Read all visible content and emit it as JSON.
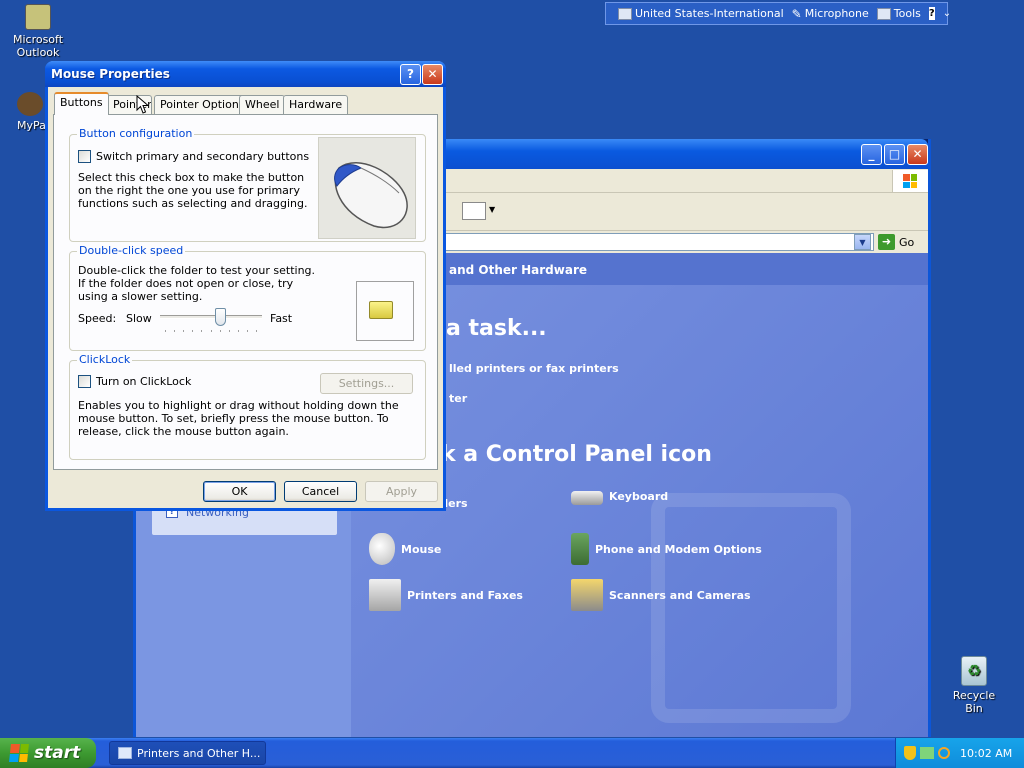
{
  "language_bar": {
    "language": "United States-International",
    "microphone": "Microphone",
    "tools": "Tools",
    "help": "?",
    "more": "⌄"
  },
  "desktop": {
    "icons": [
      {
        "label": "Microsoft Outlook"
      },
      {
        "label": "MyPa"
      },
      {
        "label": "Recycle Bin"
      }
    ]
  },
  "control_panel": {
    "address_go": "Go",
    "header_title": "and Other Hardware",
    "pick_task": "a task...",
    "task_links": [
      "lled printers or fax printers",
      "ter"
    ],
    "pick_icon": "k a Control Panel icon",
    "sidebar_link": "Networking",
    "icons": [
      {
        "label": "ontrollers"
      },
      {
        "label": "Keyboard"
      },
      {
        "label": "Mouse"
      },
      {
        "label": "Phone and Modem Options"
      },
      {
        "label": "Printers and Faxes"
      },
      {
        "label": "Scanners and Cameras"
      }
    ]
  },
  "dialog": {
    "title": "Mouse Properties",
    "help_btn": "?",
    "close_btn": "✕",
    "tabs": [
      "Buttons",
      "Pointers",
      "Pointer Options",
      "Wheel",
      "Hardware"
    ],
    "active_tab": "Buttons",
    "button_config": {
      "legend": "Button configuration",
      "checkbox_label": "Switch primary and secondary buttons",
      "checked": false,
      "description": "Select this check box to make the button on the right the one you use for primary functions such as selecting and dragging."
    },
    "double_click": {
      "legend": "Double-click speed",
      "description": "Double-click the folder to test your setting. If the folder does not open or close, try using a slower setting.",
      "speed_label": "Speed:",
      "slow_label": "Slow",
      "fast_label": "Fast",
      "slider_value": 0.6
    },
    "clicklock": {
      "legend": "ClickLock",
      "checkbox_label": "Turn on ClickLock",
      "checked": false,
      "settings_btn": "Settings...",
      "description": "Enables you to highlight or drag without holding down the mouse button. To set, briefly press the mouse button. To release, click the mouse button again."
    },
    "ok": "OK",
    "cancel": "Cancel",
    "apply": "Apply"
  },
  "taskbar": {
    "start": "start",
    "task_item": "Printers and Other H...",
    "clock": "10:02 AM"
  },
  "colors": {
    "desktop": "#1f4fa6",
    "title_blue": "#0a57e0",
    "start_green": "#3d9a31",
    "legend_blue": "#0046d5",
    "tab_highlight": "#e68b2c"
  }
}
